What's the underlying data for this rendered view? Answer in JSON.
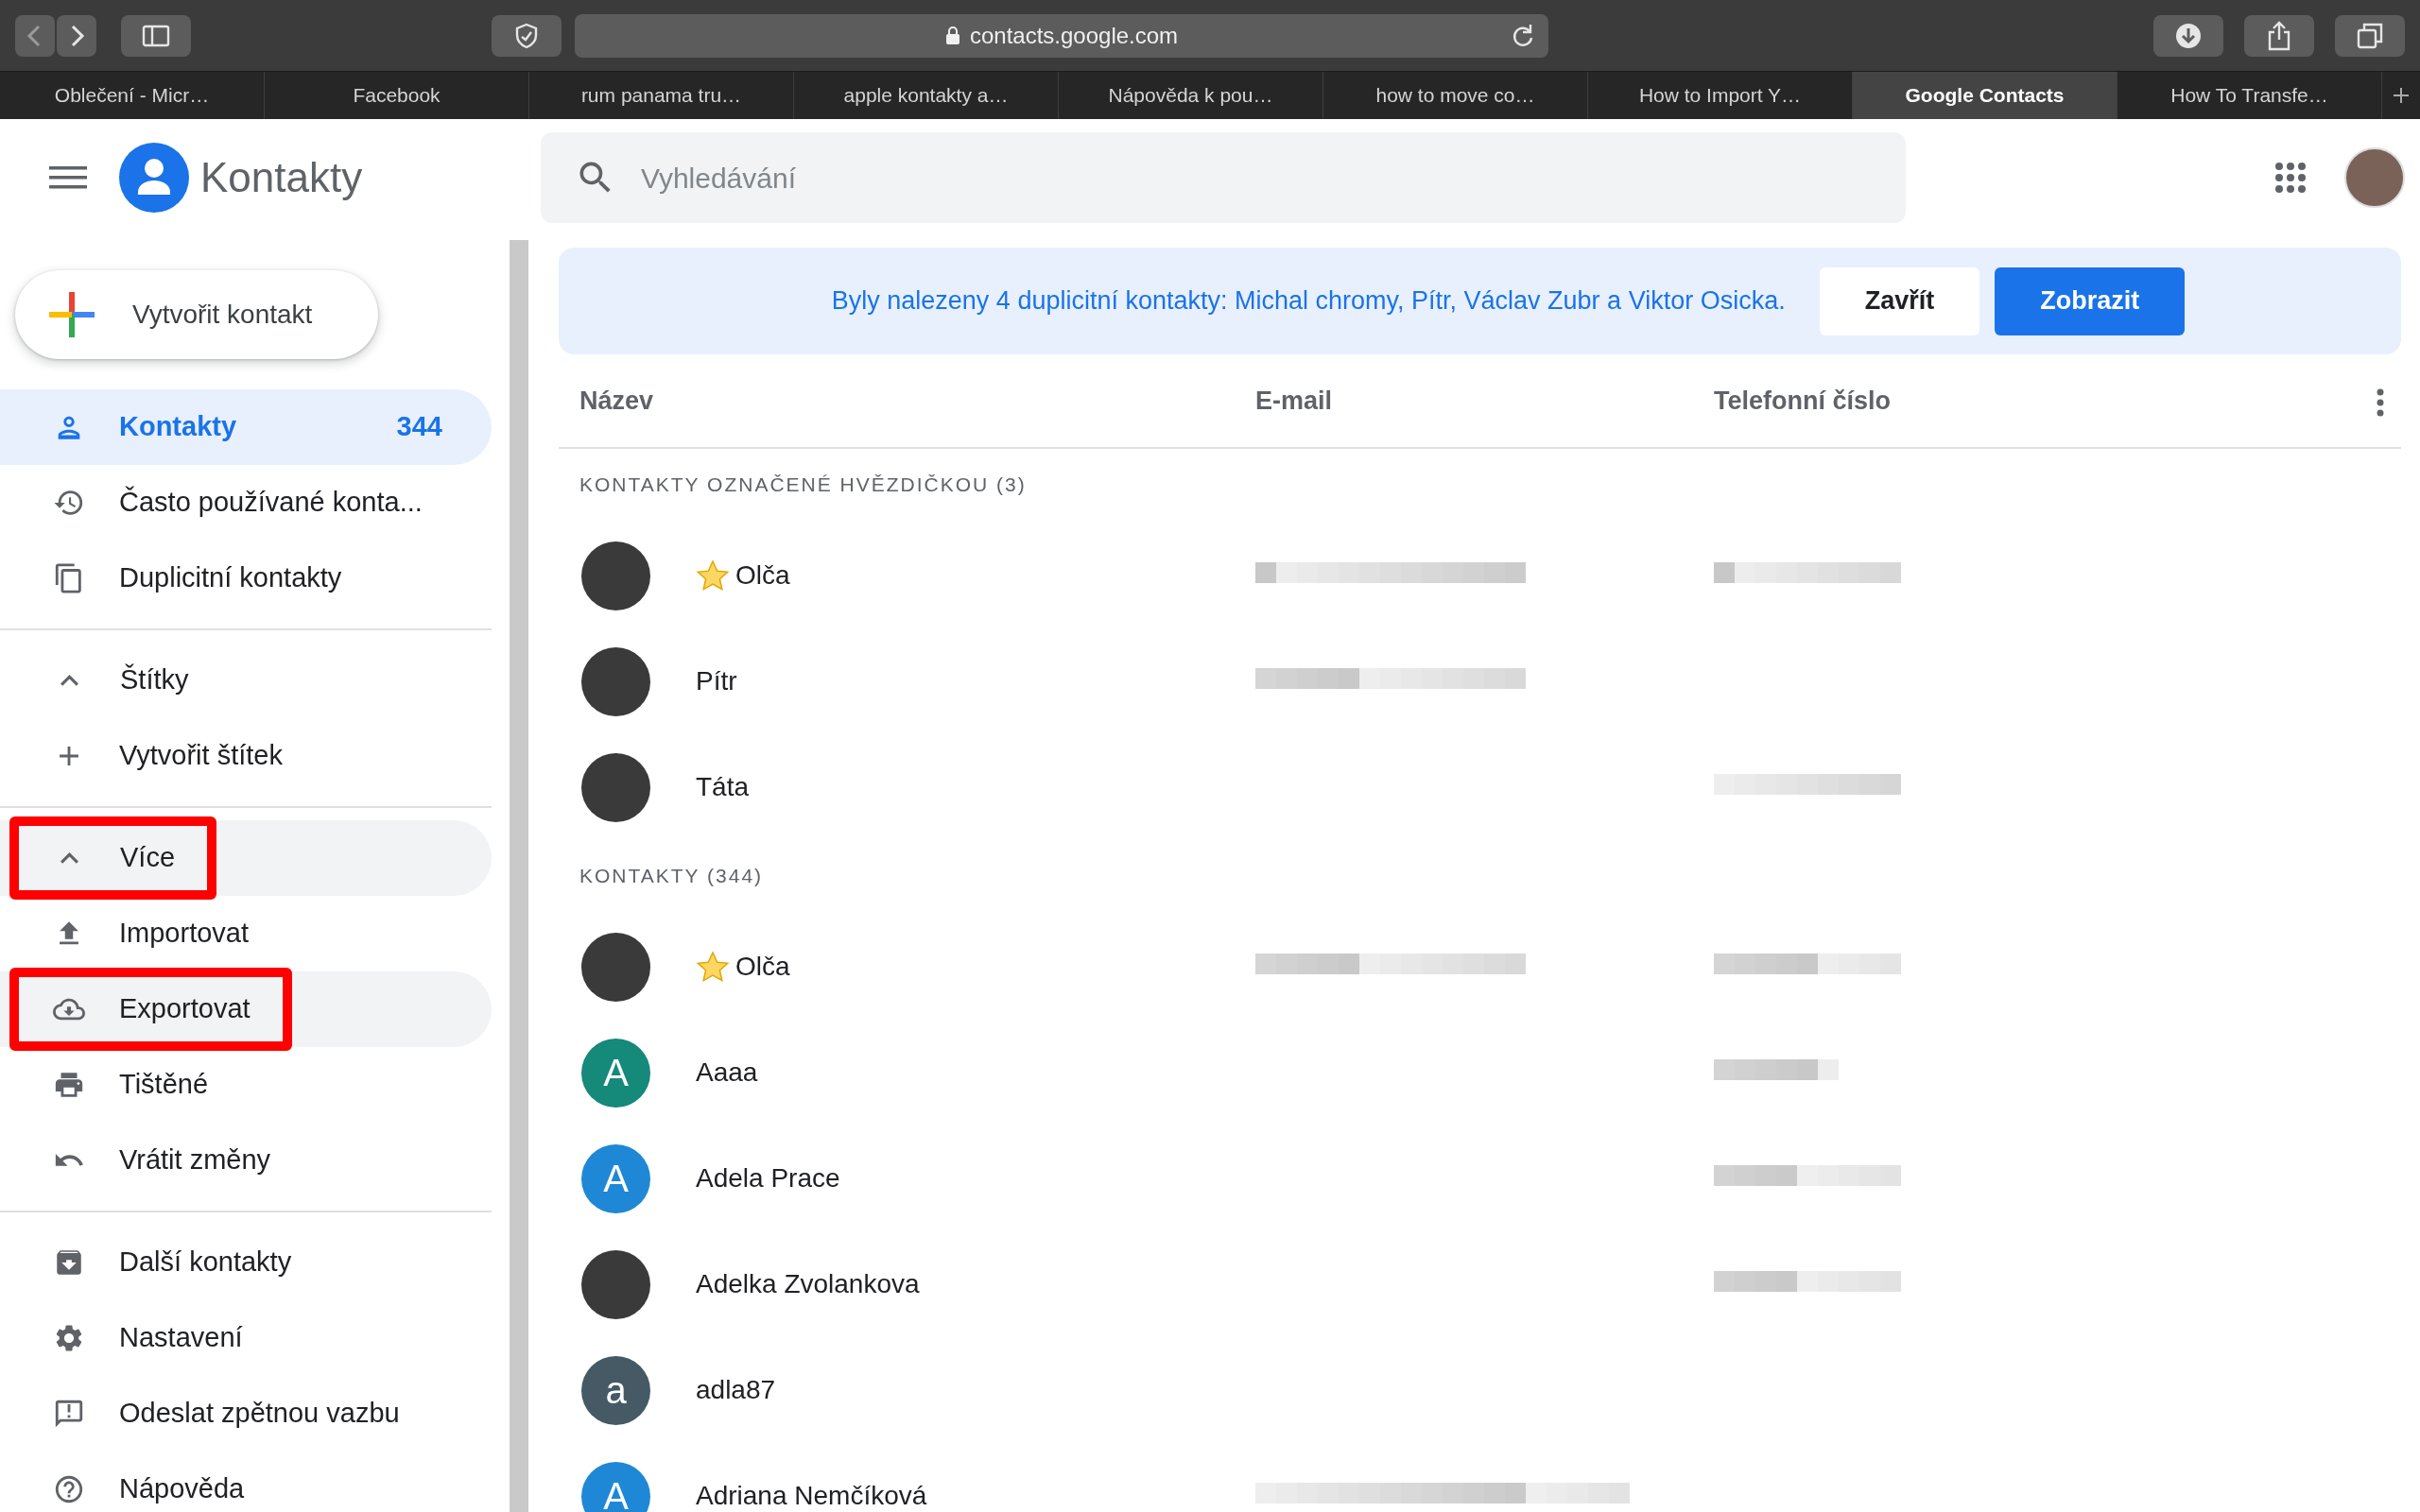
{
  "browser": {
    "address": "contacts.google.com",
    "tabs": [
      {
        "label": "Oblečení - Micr…",
        "selected": false
      },
      {
        "label": "Facebook",
        "selected": false
      },
      {
        "label": "rum panama tru…",
        "selected": false
      },
      {
        "label": "apple kontakty a…",
        "selected": false
      },
      {
        "label": "Nápověda k pou…",
        "selected": false
      },
      {
        "label": "how to move co…",
        "selected": false
      },
      {
        "label": "How to Import Y…",
        "selected": false
      },
      {
        "label": "Google Contacts",
        "selected": true
      },
      {
        "label": "How To Transfe…",
        "selected": false
      }
    ]
  },
  "app": {
    "title": "Kontakty",
    "search": {
      "placeholder": "Vyhledávání"
    }
  },
  "create_button": "Vytvořit kontakt",
  "sidebar": {
    "groups": [
      [
        {
          "kind": "contacts",
          "label": "Kontakty",
          "count": "344",
          "selected": true,
          "hovered": false,
          "highlighted": false
        },
        {
          "kind": "frequent",
          "label": "Často používané konta...",
          "selected": false,
          "hovered": false,
          "highlighted": false
        },
        {
          "kind": "duplicates",
          "label": "Duplicitní kontakty",
          "selected": false,
          "hovered": false,
          "highlighted": false
        }
      ],
      [
        {
          "kind": "toggle",
          "label": "Štítky",
          "expanded": true,
          "selected": false,
          "hovered": false,
          "highlighted": false
        },
        {
          "kind": "add",
          "label": "Vytvořit štítek",
          "selected": false,
          "hovered": false,
          "highlighted": false
        }
      ],
      [
        {
          "kind": "toggle",
          "label": "Více",
          "expanded": true,
          "selected": false,
          "hovered": true,
          "highlighted": true
        },
        {
          "kind": "import",
          "label": "Importovat",
          "selected": false,
          "hovered": false,
          "highlighted": false
        },
        {
          "kind": "export",
          "label": "Exportovat",
          "selected": false,
          "hovered": true,
          "highlighted": true
        },
        {
          "kind": "print",
          "label": "Tištěné",
          "selected": false,
          "hovered": false,
          "highlighted": false
        },
        {
          "kind": "undo",
          "label": "Vrátit změny",
          "selected": false,
          "hovered": false,
          "highlighted": false
        }
      ],
      [
        {
          "kind": "other",
          "label": "Další kontakty",
          "selected": false,
          "hovered": false,
          "highlighted": false
        },
        {
          "kind": "settings",
          "label": "Nastavení",
          "selected": false,
          "hovered": false,
          "highlighted": false
        },
        {
          "kind": "feedback",
          "label": "Odeslat zpětnou vazbu",
          "selected": false,
          "hovered": false,
          "highlighted": false
        },
        {
          "kind": "help",
          "label": "Nápověda",
          "selected": false,
          "hovered": false,
          "highlighted": false
        }
      ]
    ]
  },
  "banner": {
    "message": "Byly nalezeny 4 duplicitní kontakty: Michal chromy, Pítr, Václav Zubr a Viktor Osicka.",
    "buttons": [
      {
        "kind": "secondary",
        "label": "Zavřít"
      },
      {
        "kind": "primary",
        "label": "Zobrazit"
      }
    ]
  },
  "table": {
    "columns": [
      "Název",
      "E-mail",
      "Telefonní číslo"
    ],
    "sections": [
      {
        "title": "KONTAKTY OZNAČENÉ HVĚZDIČKOU (3)",
        "rows": [
          {
            "kind": "photo",
            "name": "Olča",
            "starred": true,
            "email_blurred": true,
            "phone_blurred": true
          },
          {
            "kind": "photo",
            "name": "Pítr",
            "starred": false,
            "email_blurred": true,
            "phone_blurred": false
          },
          {
            "kind": "photo",
            "name": "Táta",
            "starred": false,
            "email_blurred": false,
            "phone_blurred": true
          }
        ]
      },
      {
        "title": "KONTAKTY (344)",
        "rows": [
          {
            "kind": "photo",
            "name": "Olča",
            "starred": true,
            "email_blurred": true,
            "phone_blurred": true
          },
          {
            "kind": "letter",
            "letter": "A",
            "color": "#15897a",
            "name": "Aaaa",
            "starred": false,
            "email_blurred": false,
            "phone_blurred": true
          },
          {
            "kind": "letter",
            "letter": "A",
            "color": "#1e88d6",
            "name": "Adela Prace",
            "starred": false,
            "email_blurred": false,
            "phone_blurred": true
          },
          {
            "kind": "photo",
            "name": "Adelka Zvolankova",
            "starred": false,
            "email_blurred": false,
            "phone_blurred": true
          },
          {
            "kind": "letter",
            "letter": "a",
            "color": "#455a64",
            "name": "adla87",
            "starred": false,
            "email_blurred": false,
            "phone_blurred": false
          },
          {
            "kind": "letter",
            "letter": "A",
            "color": "#1e88d6",
            "name": "Adriana Nemčíková",
            "starred": false,
            "email_blurred": true,
            "phone_blurred": false
          }
        ]
      }
    ]
  }
}
